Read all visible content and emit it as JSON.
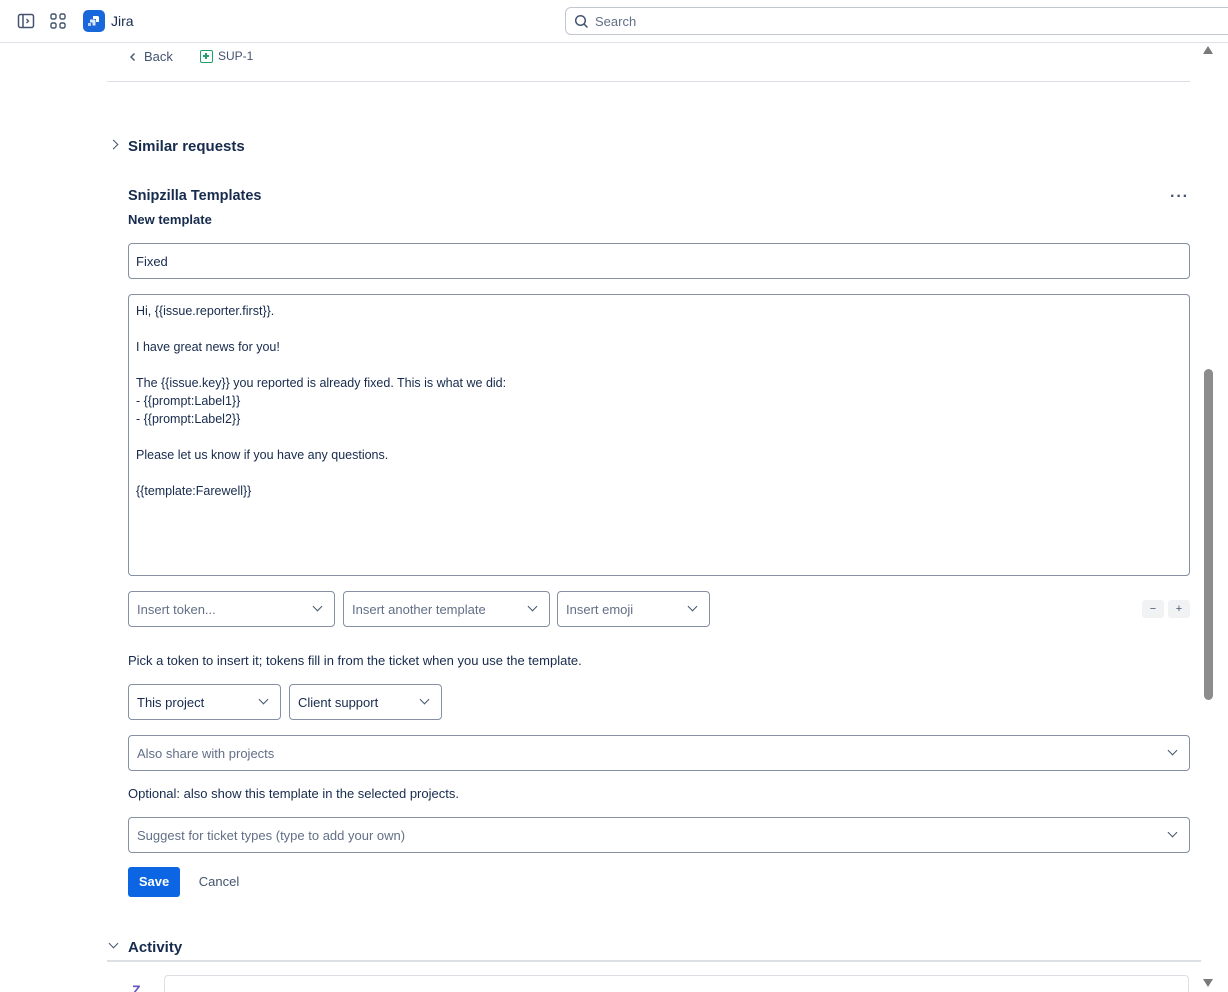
{
  "topbar": {
    "app_name": "Jira",
    "search_placeholder": "Search"
  },
  "breadcrumb": {
    "back_label": "Back",
    "issue_key": "SUP-1"
  },
  "sections": {
    "similar_requests": "Similar requests",
    "activity": "Activity"
  },
  "snipzilla": {
    "title": "Snipzilla Templates",
    "more_label": "···",
    "subtitle": "New template",
    "template_name": "Fixed",
    "body_lines": [
      "Hi, {{issue.reporter.first}}.",
      "",
      "I have great news for you!",
      "",
      "The {{issue.key}} you reported is already fixed. This is what we did:",
      "- {{prompt:Label1}}",
      "- {{prompt:Label2}}",
      "",
      "Please let us know if you have any questions.",
      "",
      "{{template:Farewell}}"
    ],
    "insert_token": "Insert token...",
    "insert_template": "Insert another template",
    "insert_emoji": "Insert emoji",
    "minus_label": "−",
    "plus_label": "+",
    "token_help": "Pick a token to insert it; tokens fill in from the ticket when you use the template.",
    "scope_value": "This project",
    "project_value": "Client support",
    "share_placeholder": "Also share with projects",
    "share_help": "Optional: also show this template in the selected projects.",
    "ticket_types_placeholder": "Suggest for ticket types (type to add your own)",
    "save_label": "Save",
    "cancel_label": "Cancel"
  },
  "colors": {
    "primary": "#0c66e4",
    "jira_brand": "#1868db",
    "issue_icon": "#22a06b"
  }
}
